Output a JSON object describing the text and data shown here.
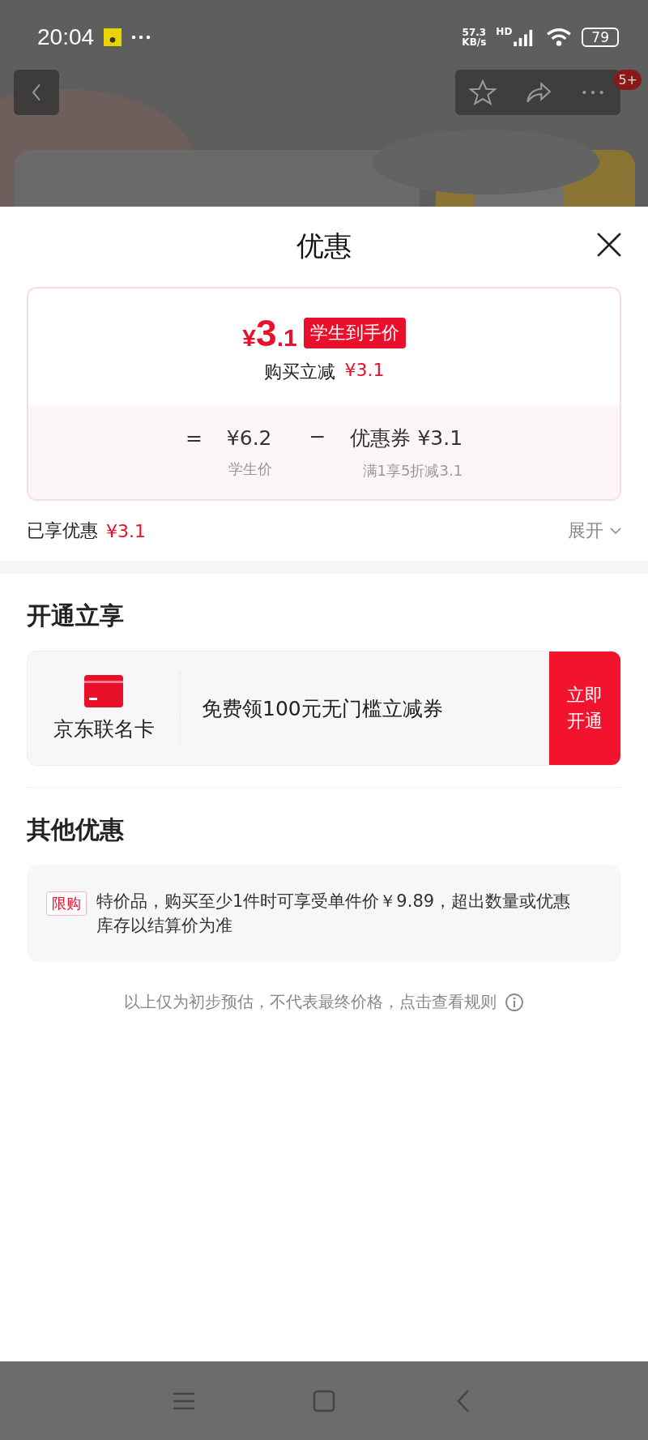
{
  "status_bar": {
    "time": "20:04",
    "net_speed": "57.3",
    "net_unit": "KB/s",
    "network": "HD",
    "battery": "79"
  },
  "top_bar": {
    "cart_badge": "5+"
  },
  "sheet": {
    "title": "优惠",
    "price": {
      "currency": "¥",
      "integer": "3",
      "decimal": ".1",
      "tag": "学生到手价",
      "subtitle": "购买立减",
      "subtitle_amount": "¥3.1"
    },
    "breakdown": [
      {
        "op": "=",
        "value": "¥6.2",
        "label": "学生价"
      },
      {
        "op": "−",
        "value": "优惠券 ¥3.1",
        "label": "满1享5折减3.1"
      }
    ],
    "enjoyed": {
      "label": "已享优惠",
      "amount": "¥3.1",
      "toggle": "展开"
    }
  },
  "open_benefit": {
    "title": "开通立享",
    "card_name": "京东联名卡",
    "offer": "免费领100元无门槛立减券",
    "button": "立即开通"
  },
  "other_offers": {
    "title": "其他优惠",
    "items": [
      {
        "tag": "限购",
        "text": "特价品，购买至少1件时可享受单件价￥9.89，超出数量或优惠库存以结算价为准"
      }
    ]
  },
  "footer_note": "以上仅为初步预估，不代表最终价格，点击查看规则"
}
